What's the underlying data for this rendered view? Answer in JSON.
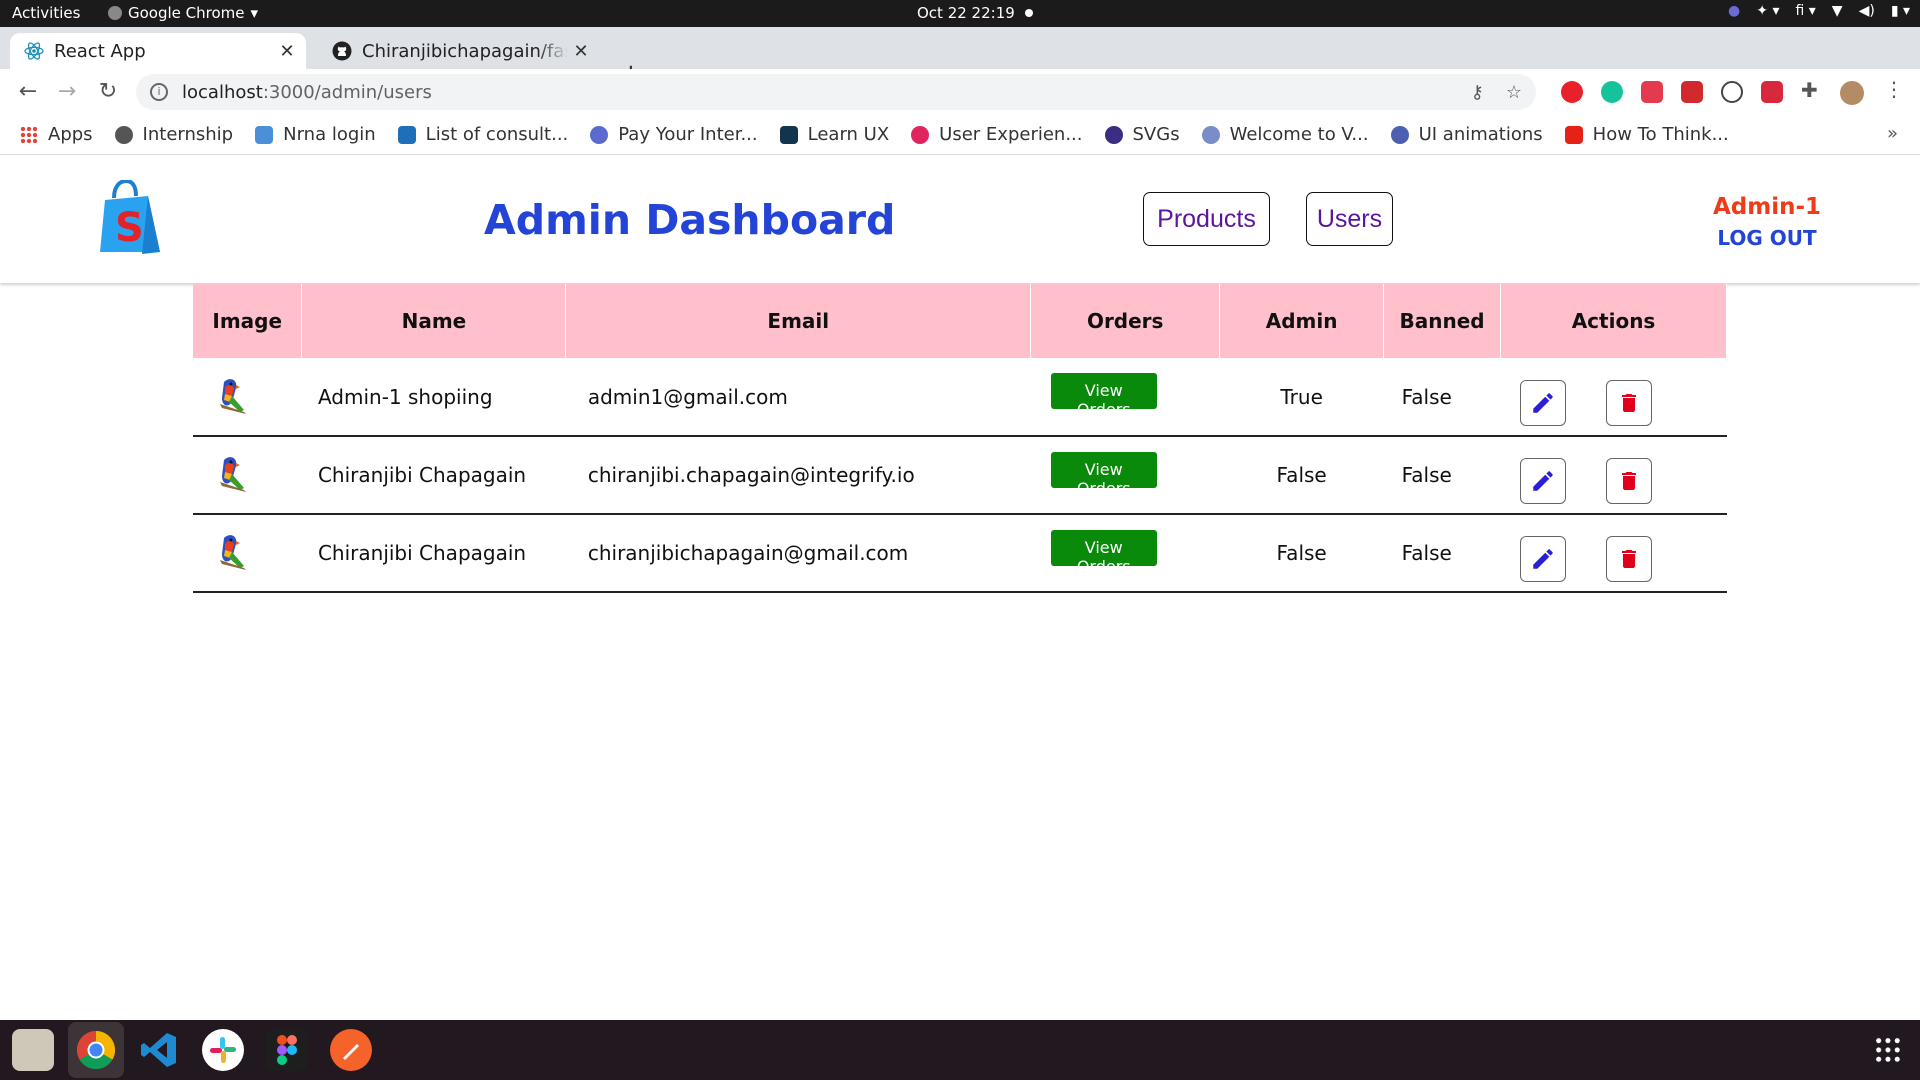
{
  "system": {
    "activities": "Activities",
    "app_name": "Google Chrome",
    "clock": "Oct 22  22:19",
    "keyboard_layout": "fi"
  },
  "browser": {
    "tabs": [
      {
        "title": "React App",
        "active": true
      },
      {
        "title": "Chiranjibichapagain/fast-t",
        "active": false
      }
    ],
    "url": {
      "host": "localhost",
      "path": ":3000/admin/users"
    },
    "bookmarks": [
      {
        "label": "Apps",
        "color": "#ea4335"
      },
      {
        "label": "Internship",
        "color": "#555555"
      },
      {
        "label": "Nrna login",
        "color": "#4a90d9"
      },
      {
        "label": "List of consult...",
        "color": "#1e6fb5"
      },
      {
        "label": "Pay Your Inter...",
        "color": "#5a6acf"
      },
      {
        "label": "Learn UX",
        "color": "#12344d"
      },
      {
        "label": "User Experien...",
        "color": "#e0245e"
      },
      {
        "label": "SVGs",
        "color": "#3b2d83"
      },
      {
        "label": "Welcome to V...",
        "color": "#7a8dc9"
      },
      {
        "label": "UI animations",
        "color": "#4d5fb3"
      },
      {
        "label": "How To Think...",
        "color": "#e62117"
      }
    ]
  },
  "header": {
    "title": "Admin Dashboard",
    "nav": {
      "products": "Products",
      "users": "Users"
    },
    "admin_name": "Admin-1",
    "logout": "LOG OUT",
    "colors": {
      "title": "#2344d6",
      "admin_name": "#ef3b1a",
      "nav_text": "#5a169e"
    }
  },
  "table": {
    "columns": [
      "Image",
      "Name",
      "Email",
      "Orders",
      "Admin",
      "Banned",
      "Actions"
    ],
    "view_orders_label": "View Orders",
    "rows": [
      {
        "name": "Admin-1 shopiing",
        "email": "admin1@gmail.com",
        "admin": "True",
        "banned": "False"
      },
      {
        "name": "Chiranjibi Chapagain",
        "email": "chiranjibi.chapagain@integrify.io",
        "admin": "False",
        "banned": "False"
      },
      {
        "name": "Chiranjibi Chapagain",
        "email": "chiranjibichapagain@gmail.com",
        "admin": "False",
        "banned": "False"
      }
    ],
    "colors": {
      "header_bg": "#ffc0cb",
      "view_orders_bg": "#0a8a0a",
      "edit_icon": "#2a1fd6",
      "delete_icon": "#e0001b"
    }
  }
}
